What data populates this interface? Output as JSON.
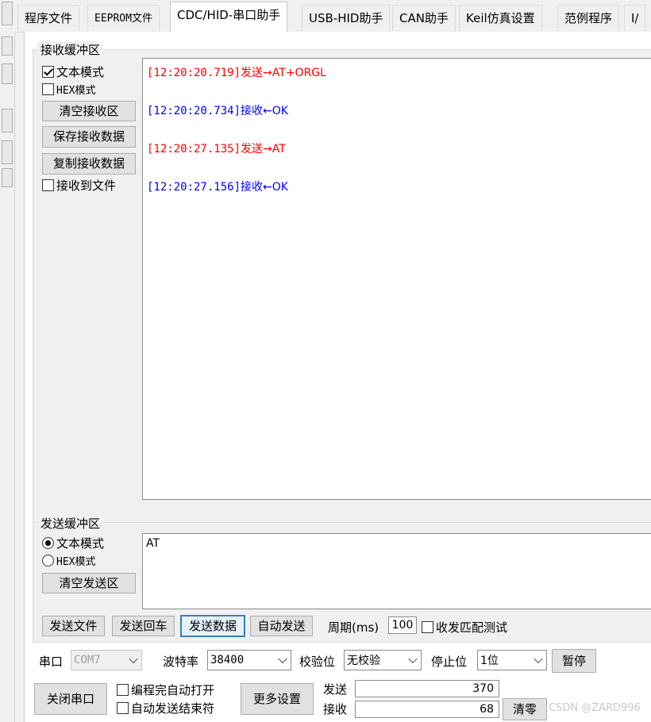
{
  "tabs": [
    {
      "label": "程序文件"
    },
    {
      "label": "EEPROM文件"
    },
    {
      "label": "CDC/HID-串口助手"
    },
    {
      "label": "USB-HID助手"
    },
    {
      "label": "CAN助手"
    },
    {
      "label": "Keil仿真设置"
    },
    {
      "label": "范例程序"
    },
    {
      "label": "I/"
    }
  ],
  "receive": {
    "title": "接收缓冲区",
    "text_mode_label": "文本模式",
    "hex_mode_label": "HEX模式",
    "clear_label": "清空接收区",
    "save_label": "保存接收数据",
    "copy_label": "复制接收数据",
    "to_file_label": "接收到文件",
    "log": [
      {
        "time": "[12:20:20.719]",
        "text": "发送→AT+ORGL",
        "color": "#ff0000"
      },
      {
        "time": "[12:20:20.734]",
        "text": "接收←OK",
        "color": "#0000ff"
      },
      {
        "time": "[12:20:27.135]",
        "text": "发送→AT",
        "color": "#ff0000"
      },
      {
        "time": "[12:20:27.156]",
        "text": "接收←OK",
        "color": "#0000ff"
      }
    ]
  },
  "send": {
    "title": "发送缓冲区",
    "text_mode_label": "文本模式",
    "hex_mode_label": "HEX模式",
    "clear_label": "清空发送区",
    "content": "AT",
    "send_file_label": "发送文件",
    "send_enter_label": "发送回车",
    "send_data_label": "发送数据",
    "auto_send_label": "自动发送",
    "period_label": "周期(ms)",
    "period_value": "100",
    "match_test_label": "收发匹配测试"
  },
  "port": {
    "port_label": "串口",
    "port_value": "COM7",
    "baud_label": "波特率",
    "baud_value": "38400",
    "parity_label": "校验位",
    "parity_value": "无校验",
    "stop_label": "停止位",
    "stop_value": "1位",
    "pause_label": "暂停",
    "close_label": "关闭串口",
    "auto_open_label": "编程完自动打开",
    "auto_end_label": "自动发送结束符",
    "more_label": "更多设置",
    "sent_label": "发送",
    "sent_count": "370",
    "recv_label": "接收",
    "recv_count": "68",
    "clear_count_label": "清零"
  },
  "watermark": "CSDN @ZARD996"
}
